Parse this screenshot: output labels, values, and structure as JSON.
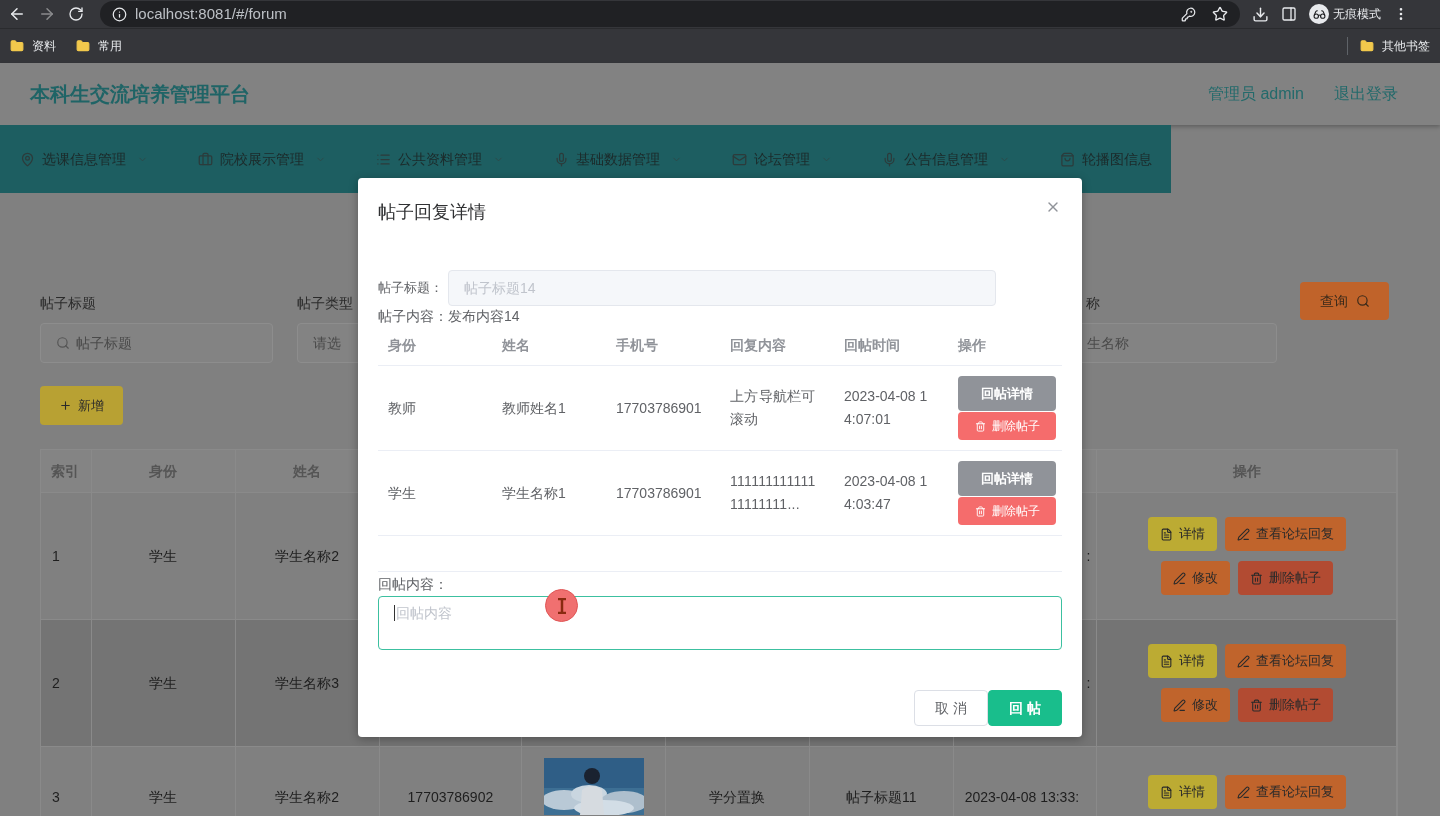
{
  "browser": {
    "url": "localhost:8081/#/forum",
    "incognito_label": "无痕模式",
    "bookmarks": [
      "资料",
      "常用"
    ],
    "other_bookmarks": "其他书签"
  },
  "header": {
    "title": "本科生交流培养管理平台",
    "user": "管理员 admin",
    "logout": "退出登录"
  },
  "nav": [
    {
      "label": "选课信息管理",
      "has_submenu": true
    },
    {
      "label": "院校展示管理",
      "has_submenu": true
    },
    {
      "label": "公共资料管理",
      "has_submenu": true
    },
    {
      "label": "基础数据管理",
      "has_submenu": true
    },
    {
      "label": "论坛管理",
      "has_submenu": true
    },
    {
      "label": "公告信息管理",
      "has_submenu": true
    },
    {
      "label": "轮播图信息",
      "has_submenu": false
    }
  ],
  "search": {
    "fields": [
      {
        "label": "帖子标题",
        "placeholder": "帖子标题"
      },
      {
        "label": "帖子类型",
        "placeholder": "请选"
      },
      {
        "label": "称",
        "placeholder": "生名称"
      }
    ],
    "query_button": "查询"
  },
  "add_button": "新增",
  "table": {
    "columns": [
      "索引",
      "身份",
      "姓名",
      "操作"
    ],
    "rows": [
      {
        "index": "1",
        "identity": "学生",
        "name": "学生名称2",
        "time": ":",
        "hovered": false,
        "actions": [
          {
            "kind": "detail",
            "label": "详情"
          },
          {
            "kind": "replies",
            "label": "查看论坛回复"
          },
          {
            "kind": "edit",
            "label": "修改"
          },
          {
            "kind": "delete",
            "label": "删除帖子"
          }
        ]
      },
      {
        "index": "2",
        "identity": "学生",
        "name": "学生名称3",
        "time": ":",
        "hovered": true,
        "actions": [
          {
            "kind": "detail",
            "label": "详情"
          },
          {
            "kind": "replies",
            "label": "查看论坛回复"
          },
          {
            "kind": "edit",
            "label": "修改"
          },
          {
            "kind": "delete",
            "label": "删除帖子"
          }
        ]
      },
      {
        "index": "3",
        "identity": "学生",
        "name": "学生名称2",
        "phone": "17703786902",
        "image": {
          "kind": "picture"
        },
        "type": "学分置换",
        "title": "帖子标题11",
        "time": "2023-04-08 13:33:",
        "hovered": false,
        "actions": [
          {
            "kind": "detail",
            "label": "详情"
          },
          {
            "kind": "replies",
            "label": "查看论坛回复"
          }
        ]
      }
    ]
  },
  "dialog": {
    "title": "帖子回复详情",
    "title_label": "帖子标题：",
    "title_value": "帖子标题14",
    "title_disabled": true,
    "content_text": "帖子内容：发布内容14",
    "columns": [
      "身份",
      "姓名",
      "手机号",
      "回复内容",
      "回帖时间",
      "操作"
    ],
    "rows": [
      {
        "identity": "教师",
        "name": "教师姓名1",
        "phone": "17703786901",
        "content": "上方导航栏可滚动",
        "time": "2023-04-08 14:07:01",
        "actions": [
          {
            "kind": "detail",
            "label": "回帖详情"
          },
          {
            "kind": "delete",
            "label": "删除帖子"
          }
        ]
      },
      {
        "identity": "学生",
        "name": "学生名称1",
        "phone": "17703786901",
        "content": "11111111111111111111...",
        "time": "2023-04-08 14:03:47",
        "actions": [
          {
            "kind": "detail",
            "label": "回帖详情"
          },
          {
            "kind": "delete",
            "label": "删除帖子"
          }
        ]
      }
    ],
    "reply": {
      "label": "回帖内容：",
      "placeholder": "回帖内容",
      "focused": true
    },
    "buttons": [
      {
        "kind": "cancel",
        "label": "取 消"
      },
      {
        "kind": "primary",
        "label": "回 帖"
      }
    ]
  }
}
